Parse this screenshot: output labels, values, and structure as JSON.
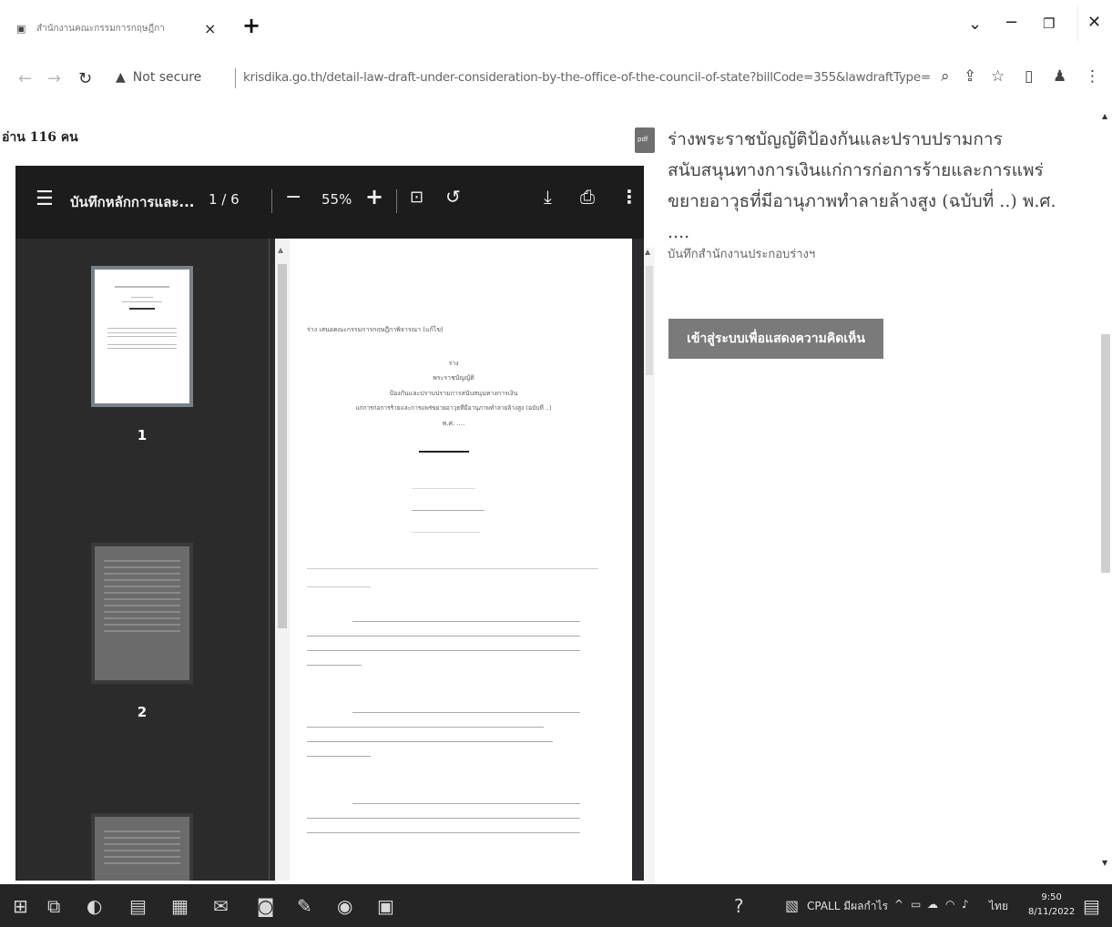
{
  "browser": {
    "tab_title": "สำนักงานคณะกรรมการกฤษฎีกา",
    "tab_close": "×",
    "new_tab": "+",
    "win_min": "−",
    "win_chevron": "⌄",
    "win_max": "❐",
    "win_close": "✕",
    "secure_label": "Not secure",
    "url": "krisdika.go.th/detail-law-draft-under-consideration-by-the-office-of-the-council-of-state?billCode=355&lawdraftType=betwe..."
  },
  "page": {
    "readers": "อ่าน 116 คน",
    "viewer": {
      "doc_title": "บันทึกหลักการและ...",
      "page_indicator": "1 / 6",
      "zoom": "55%",
      "thumbnails": [
        {
          "number": "1"
        },
        {
          "number": "2"
        }
      ],
      "content_lines": {
        "header": "ร่าง เสนอคณะกรรมการกฤษฎีกาพิจารณา (แก้ไข)",
        "l1": "ร่าง",
        "l2": "พระราชบัญญัติ",
        "l3": "ป้องกันและปราบปรามการสนับสนุนทางการเงิน",
        "l4": "แก่การก่อการร้ายและการแพร่ขยายอาวุธที่มีอานุภาพทำลายล้างสูง (ฉบับที่ ..)",
        "l5": "พ.ศ. ...."
      }
    },
    "doc_heading": "ร่างพระราชบัญญัติป้องกันและปราบปรามการสนับสนุนทางการเงินแก่การก่อการร้ายและการแพร่ขยายอาวุธที่มีอานุภาพทำลายล้างสูง (ฉบับที่ ..) พ.ศ. ....",
    "doc_subtitle": "บันทึกสำนักงานประกอบร่างฯ",
    "cta_label": "เข้าสู่ระบบเพื่อแสดงความคิดเห็น"
  },
  "taskbar": {
    "tray_label": "CPALL มีผลกำไร",
    "lang": "ไทย",
    "time": "9:50",
    "date": "8/11/2022"
  }
}
